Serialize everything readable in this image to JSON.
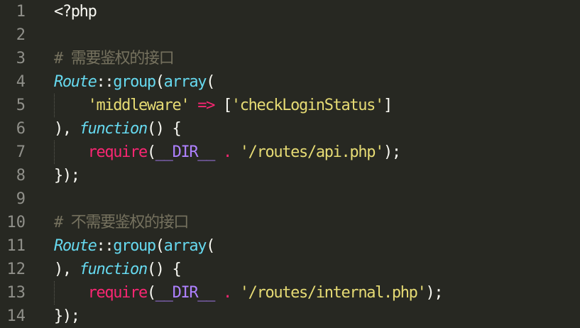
{
  "editor": {
    "language": "php",
    "theme": "dark",
    "background": "#272822",
    "lines": [
      {
        "number": "1",
        "tokens": [
          {
            "text": "<?php",
            "type": "default"
          }
        ]
      },
      {
        "number": "2",
        "tokens": []
      },
      {
        "number": "3",
        "tokens": [
          {
            "text": "# 需要鉴权的接口",
            "type": "comment"
          }
        ]
      },
      {
        "number": "4",
        "tokens": [
          {
            "text": "Route",
            "type": "class"
          },
          {
            "text": "::",
            "type": "default"
          },
          {
            "text": "group",
            "type": "func"
          },
          {
            "text": "(",
            "type": "default"
          },
          {
            "text": "array",
            "type": "func"
          },
          {
            "text": "(",
            "type": "default"
          }
        ]
      },
      {
        "number": "5",
        "tokens": [
          {
            "text": "    ",
            "type": "default"
          },
          {
            "text": "'middleware'",
            "type": "string"
          },
          {
            "text": " ",
            "type": "default"
          },
          {
            "text": "=>",
            "type": "op"
          },
          {
            "text": " [",
            "type": "default"
          },
          {
            "text": "'checkLoginStatus'",
            "type": "string"
          },
          {
            "text": "]",
            "type": "default"
          }
        ]
      },
      {
        "number": "6",
        "tokens": [
          {
            "text": "), ",
            "type": "default"
          },
          {
            "text": "function",
            "type": "storage"
          },
          {
            "text": "() {",
            "type": "default"
          }
        ]
      },
      {
        "number": "7",
        "tokens": [
          {
            "text": "    ",
            "type": "default"
          },
          {
            "text": "require",
            "type": "keyword"
          },
          {
            "text": "(",
            "type": "default"
          },
          {
            "text": "__DIR__",
            "type": "const"
          },
          {
            "text": " ",
            "type": "default"
          },
          {
            "text": ".",
            "type": "op"
          },
          {
            "text": " ",
            "type": "default"
          },
          {
            "text": "'/routes/api.php'",
            "type": "string"
          },
          {
            "text": ");",
            "type": "default"
          }
        ]
      },
      {
        "number": "8",
        "tokens": [
          {
            "text": "});",
            "type": "default"
          }
        ]
      },
      {
        "number": "9",
        "tokens": []
      },
      {
        "number": "10",
        "tokens": [
          {
            "text": "# 不需要鉴权的接口",
            "type": "comment"
          }
        ]
      },
      {
        "number": "11",
        "tokens": [
          {
            "text": "Route",
            "type": "class"
          },
          {
            "text": "::",
            "type": "default"
          },
          {
            "text": "group",
            "type": "func"
          },
          {
            "text": "(",
            "type": "default"
          },
          {
            "text": "array",
            "type": "func"
          },
          {
            "text": "(",
            "type": "default"
          }
        ]
      },
      {
        "number": "12",
        "tokens": [
          {
            "text": "), ",
            "type": "default"
          },
          {
            "text": "function",
            "type": "storage"
          },
          {
            "text": "() {",
            "type": "default"
          }
        ]
      },
      {
        "number": "13",
        "tokens": [
          {
            "text": "    ",
            "type": "default"
          },
          {
            "text": "require",
            "type": "keyword"
          },
          {
            "text": "(",
            "type": "default"
          },
          {
            "text": "__DIR__",
            "type": "const"
          },
          {
            "text": " ",
            "type": "default"
          },
          {
            "text": ".",
            "type": "op"
          },
          {
            "text": " ",
            "type": "default"
          },
          {
            "text": "'/routes/internal.php'",
            "type": "string"
          },
          {
            "text": ");",
            "type": "default"
          }
        ]
      },
      {
        "number": "14",
        "tokens": [
          {
            "text": "});",
            "type": "default"
          }
        ]
      }
    ]
  }
}
